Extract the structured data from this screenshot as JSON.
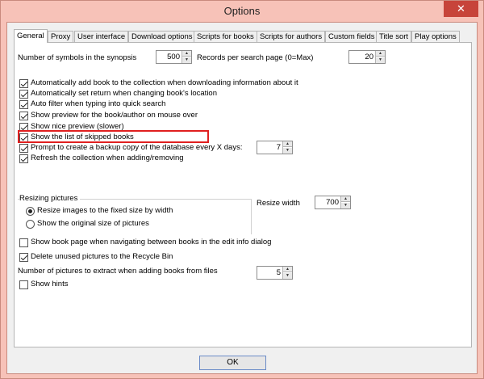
{
  "window": {
    "title": "Options",
    "close_glyph": "✕"
  },
  "tabs": [
    {
      "label": "General",
      "active": true
    },
    {
      "label": "Proxy"
    },
    {
      "label": "User interface"
    },
    {
      "label": "Download options"
    },
    {
      "label": "Scripts for books"
    },
    {
      "label": "Scripts for authors"
    },
    {
      "label": "Custom fields"
    },
    {
      "label": "Title sort"
    },
    {
      "label": "Play options"
    }
  ],
  "general": {
    "synopsis_label": "Number of symbols in the synopsis",
    "synopsis_value": "500",
    "records_label": "Records per search page (0=Max)",
    "records_value": "20",
    "checkboxes": [
      {
        "label": "Automatically add book to the collection when downloading information about it",
        "checked": true
      },
      {
        "label": "Automatically set return when changing book's location",
        "checked": true
      },
      {
        "label": "Auto filter when typing into quick search",
        "checked": true
      },
      {
        "label": "Show preview for the book/author on mouse over",
        "checked": true
      },
      {
        "label": "Show nice preview (slower)",
        "checked": true
      },
      {
        "label": "Show the list of skipped books",
        "checked": true
      },
      {
        "label": "Prompt to create a backup copy of the database every X days:",
        "checked": true
      },
      {
        "label": "Refresh the collection when adding/removing",
        "checked": true
      }
    ],
    "backup_days_value": "7",
    "resizing": {
      "group_label": "Resizing pictures",
      "option_fixed": "Resize images to the fixed size by width",
      "option_original": "Show the original size of pictures",
      "resize_width_label": "Resize width",
      "resize_width_value": "700"
    },
    "show_book_page_label": "Show book page when navigating between books in the edit info dialog",
    "delete_unused_label": "Delete unused pictures to the Recycle Bin",
    "pictures_extract_label": "Number of pictures to extract when adding books from files",
    "pictures_extract_value": "5",
    "show_hints_label": "Show hints"
  },
  "footer": {
    "ok_label": "OK"
  }
}
